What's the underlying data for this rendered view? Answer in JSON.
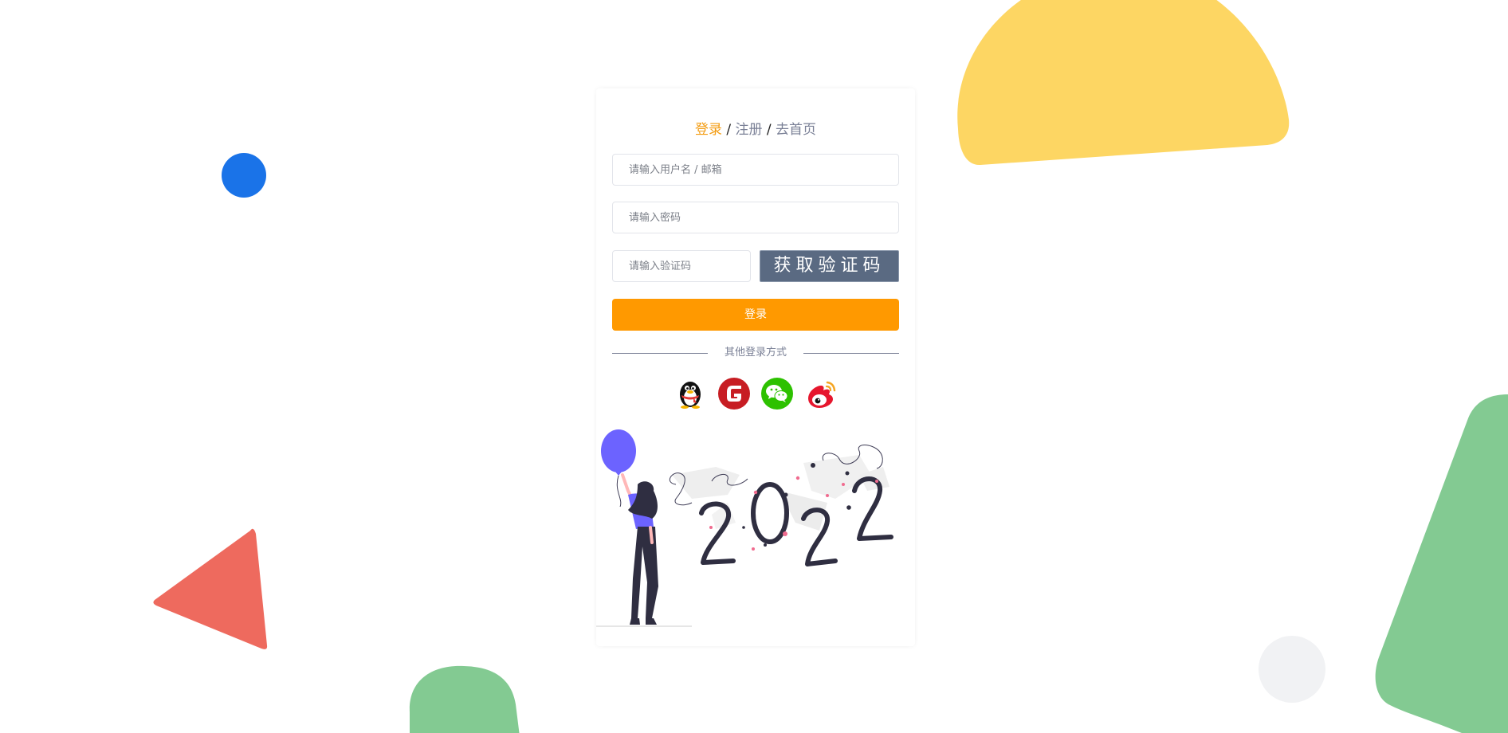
{
  "header": {
    "login_label": "登录",
    "register_label": "注册",
    "home_label": "去首页",
    "separator": "/"
  },
  "form": {
    "username_placeholder": "请输入用户名 / 邮箱",
    "password_placeholder": "请输入密码",
    "code_placeholder": "请输入验证码",
    "captcha_label": "获取验证码",
    "login_button": "登录"
  },
  "other_login": {
    "label": "其他登录方式",
    "providers": [
      "qq-icon",
      "gitee-icon",
      "wechat-icon",
      "weibo-icon"
    ]
  },
  "illustration": {
    "year_text": "2022"
  },
  "colors": {
    "accent_orange": "#ff9900",
    "link_active": "#f39c12",
    "captcha_bg": "#5a6a82",
    "bg_yellow": "#fdd663",
    "bg_blue": "#1a73e8",
    "bg_red": "#ee6a5e",
    "bg_green": "#83ca92",
    "bg_gray": "#f1f2f4"
  }
}
